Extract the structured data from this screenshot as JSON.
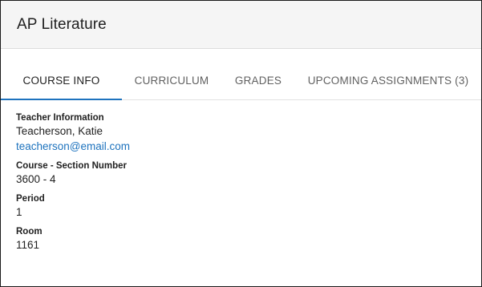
{
  "header": {
    "title": "AP Literature"
  },
  "tabs": [
    {
      "label": "COURSE INFO",
      "active": true
    },
    {
      "label": "CURRICULUM",
      "active": false
    },
    {
      "label": "GRADES",
      "active": false
    },
    {
      "label": "UPCOMING ASSIGNMENTS (3)",
      "active": false
    }
  ],
  "course_info": {
    "teacher": {
      "label": "Teacher Information",
      "name": "Teacherson, Katie",
      "email": "teacherson@email.com"
    },
    "section": {
      "label": "Course - Section Number",
      "value": "3600 - 4"
    },
    "period": {
      "label": "Period",
      "value": "1"
    },
    "room": {
      "label": "Room",
      "value": "1161"
    }
  },
  "colors": {
    "accent": "#1e73be",
    "header_bg": "#f5f5f5"
  }
}
